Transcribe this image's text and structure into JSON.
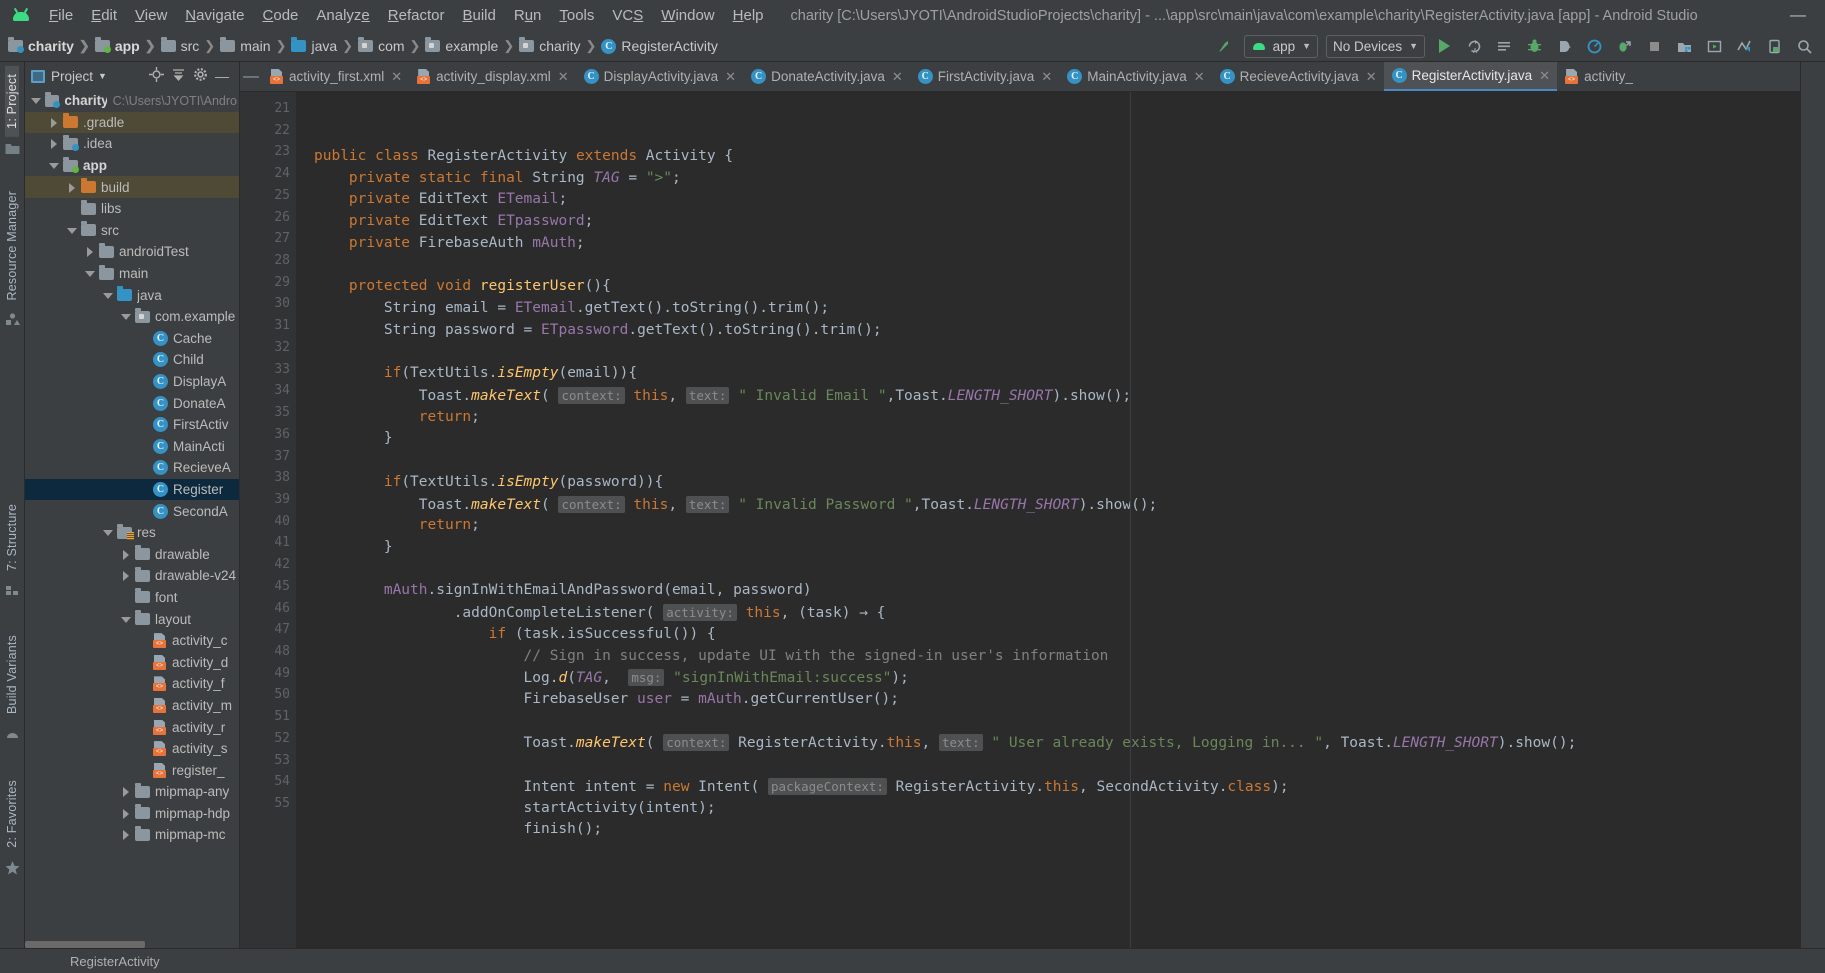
{
  "window": {
    "title": "charity [C:\\Users\\JYOTI\\AndroidStudioProjects\\charity] - ...\\app\\src\\main\\java\\com\\example\\charity\\RegisterActivity.java [app] - Android Studio",
    "minimize_label": "—"
  },
  "menubar": {
    "logo": "android-logo",
    "items": [
      "File",
      "Edit",
      "View",
      "Navigate",
      "Code",
      "Analyze",
      "Refactor",
      "Build",
      "Run",
      "Tools",
      "VCS",
      "Window",
      "Help"
    ]
  },
  "navbar": {
    "breadcrumbs": [
      {
        "label": "charity",
        "icon": "folder-module-icon",
        "bold": true
      },
      {
        "label": "app",
        "icon": "folder-module-green-icon",
        "bold": true
      },
      {
        "label": "src",
        "icon": "folder-icon",
        "bold": false
      },
      {
        "label": "main",
        "icon": "folder-icon",
        "bold": false
      },
      {
        "label": "java",
        "icon": "folder-blue-icon",
        "bold": false
      },
      {
        "label": "com",
        "icon": "package-icon",
        "bold": false
      },
      {
        "label": "example",
        "icon": "package-icon",
        "bold": false
      },
      {
        "label": "charity",
        "icon": "package-icon",
        "bold": false
      },
      {
        "label": "RegisterActivity",
        "icon": "class-icon",
        "bold": false
      }
    ],
    "run_config": "app",
    "device_selector": "No Devices",
    "icons": [
      "make-project-icon",
      "run-icon",
      "apply-changes-icon",
      "apply-code-changes-icon",
      "debug-icon",
      "attach-debugger-icon",
      "profiler-icon",
      "attach-debugger-android-icon",
      "stop-icon",
      "sdk-manager-icon",
      "avd-manager-icon",
      "layout-inspector-icon",
      "device-file-explorer-icon",
      "search-icon"
    ]
  },
  "left_strip": {
    "tabs": [
      {
        "label": "1: Project",
        "active": true
      },
      {
        "label": "Resource Manager",
        "active": false
      },
      {
        "label": "7: Structure",
        "active": false
      },
      {
        "label": "Build Variants",
        "active": false
      },
      {
        "label": "2: Favorites",
        "active": false
      }
    ]
  },
  "project_panel": {
    "title": "Project",
    "header_icons": [
      "project-view-icon",
      "chevron-down-icon",
      "locate-icon",
      "collapse-all-icon",
      "gear-icon",
      "hide-icon"
    ],
    "tree": [
      {
        "label": "charity",
        "path": "C:\\Users\\JYOTI\\Andro",
        "indent": 0,
        "arrow": "down",
        "icon": "folder-module-icon",
        "bold": true,
        "state": "normal"
      },
      {
        "label": ".gradle",
        "indent": 1,
        "arrow": "right",
        "icon": "folder-orange-icon",
        "bold": false,
        "state": "highlight"
      },
      {
        "label": ".idea",
        "indent": 1,
        "arrow": "right",
        "icon": "folder-module-icon",
        "bold": false,
        "state": "normal"
      },
      {
        "label": "app",
        "indent": 1,
        "arrow": "down",
        "icon": "folder-module-green-icon",
        "bold": true,
        "state": "normal"
      },
      {
        "label": "build",
        "indent": 2,
        "arrow": "right",
        "icon": "folder-orange-icon",
        "bold": false,
        "state": "highlight"
      },
      {
        "label": "libs",
        "indent": 2,
        "arrow": "none",
        "icon": "folder-icon",
        "bold": false,
        "state": "normal"
      },
      {
        "label": "src",
        "indent": 2,
        "arrow": "down",
        "icon": "folder-icon",
        "bold": false,
        "state": "normal"
      },
      {
        "label": "androidTest",
        "indent": 3,
        "arrow": "right",
        "icon": "folder-icon",
        "bold": false,
        "state": "normal"
      },
      {
        "label": "main",
        "indent": 3,
        "arrow": "down",
        "icon": "folder-icon",
        "bold": false,
        "state": "normal"
      },
      {
        "label": "java",
        "indent": 4,
        "arrow": "down",
        "icon": "folder-blue-icon",
        "bold": false,
        "state": "normal"
      },
      {
        "label": "com.example",
        "indent": 5,
        "arrow": "down",
        "icon": "package-icon",
        "bold": false,
        "state": "normal"
      },
      {
        "label": "Cache",
        "indent": 6,
        "arrow": "none",
        "icon": "class-icon",
        "bold": false,
        "state": "normal"
      },
      {
        "label": "Child",
        "indent": 6,
        "arrow": "none",
        "icon": "class-icon",
        "bold": false,
        "state": "normal"
      },
      {
        "label": "DisplayA",
        "indent": 6,
        "arrow": "none",
        "icon": "class-icon",
        "bold": false,
        "state": "normal"
      },
      {
        "label": "DonateA",
        "indent": 6,
        "arrow": "none",
        "icon": "class-icon",
        "bold": false,
        "state": "normal"
      },
      {
        "label": "FirstActiv",
        "indent": 6,
        "arrow": "none",
        "icon": "class-icon",
        "bold": false,
        "state": "normal"
      },
      {
        "label": "MainActi",
        "indent": 6,
        "arrow": "none",
        "icon": "class-icon",
        "bold": false,
        "state": "normal"
      },
      {
        "label": "RecieveA",
        "indent": 6,
        "arrow": "none",
        "icon": "class-icon",
        "bold": false,
        "state": "normal"
      },
      {
        "label": "Register",
        "indent": 6,
        "arrow": "none",
        "icon": "class-icon",
        "bold": false,
        "state": "selected"
      },
      {
        "label": "SecondA",
        "indent": 6,
        "arrow": "none",
        "icon": "class-icon",
        "bold": false,
        "state": "normal"
      },
      {
        "label": "res",
        "indent": 4,
        "arrow": "down",
        "icon": "folder-res-icon",
        "bold": false,
        "state": "normal"
      },
      {
        "label": "drawable",
        "indent": 5,
        "arrow": "right",
        "icon": "folder-icon",
        "bold": false,
        "state": "normal"
      },
      {
        "label": "drawable-v24",
        "indent": 5,
        "arrow": "right",
        "icon": "folder-icon",
        "bold": false,
        "state": "normal"
      },
      {
        "label": "font",
        "indent": 5,
        "arrow": "none",
        "icon": "folder-icon",
        "bold": false,
        "state": "normal"
      },
      {
        "label": "layout",
        "indent": 5,
        "arrow": "down",
        "icon": "folder-icon",
        "bold": false,
        "state": "normal"
      },
      {
        "label": "activity_c",
        "indent": 6,
        "arrow": "none",
        "icon": "xml-icon",
        "bold": false,
        "state": "normal"
      },
      {
        "label": "activity_d",
        "indent": 6,
        "arrow": "none",
        "icon": "xml-icon",
        "bold": false,
        "state": "normal"
      },
      {
        "label": "activity_f",
        "indent": 6,
        "arrow": "none",
        "icon": "xml-icon",
        "bold": false,
        "state": "normal"
      },
      {
        "label": "activity_m",
        "indent": 6,
        "arrow": "none",
        "icon": "xml-icon",
        "bold": false,
        "state": "normal"
      },
      {
        "label": "activity_r",
        "indent": 6,
        "arrow": "none",
        "icon": "xml-icon",
        "bold": false,
        "state": "normal"
      },
      {
        "label": "activity_s",
        "indent": 6,
        "arrow": "none",
        "icon": "xml-icon",
        "bold": false,
        "state": "normal"
      },
      {
        "label": "register_",
        "indent": 6,
        "arrow": "none",
        "icon": "xml-icon",
        "bold": false,
        "state": "normal"
      },
      {
        "label": "mipmap-any",
        "indent": 5,
        "arrow": "right",
        "icon": "folder-icon",
        "bold": false,
        "state": "normal"
      },
      {
        "label": "mipmap-hdp",
        "indent": 5,
        "arrow": "right",
        "icon": "folder-icon",
        "bold": false,
        "state": "normal"
      },
      {
        "label": "mipmap-mc",
        "indent": 5,
        "arrow": "right",
        "icon": "folder-icon",
        "bold": false,
        "state": "normal"
      }
    ]
  },
  "editor_tabs": [
    {
      "label": "activity_first.xml",
      "icon": "xml-icon",
      "active": false
    },
    {
      "label": "activity_display.xml",
      "icon": "xml-icon",
      "active": false
    },
    {
      "label": "DisplayActivity.java",
      "icon": "class-icon",
      "active": false
    },
    {
      "label": "DonateActivity.java",
      "icon": "class-icon",
      "active": false
    },
    {
      "label": "FirstActivity.java",
      "icon": "class-icon",
      "active": false
    },
    {
      "label": "MainActivity.java",
      "icon": "class-icon",
      "active": false
    },
    {
      "label": "RecieveActivity.java",
      "icon": "class-icon",
      "active": false
    },
    {
      "label": "RegisterActivity.java",
      "icon": "class-icon",
      "active": true
    },
    {
      "label": "activity_",
      "icon": "xml-icon",
      "active": false
    }
  ],
  "editor": {
    "first_line_number": 21,
    "gutter_lines": [
      {
        "n": "21",
        "marker": "xml-layout-icon"
      },
      {
        "n": "22",
        "marker": ""
      },
      {
        "n": "23",
        "marker": ""
      },
      {
        "n": "24",
        "marker": ""
      },
      {
        "n": "25",
        "marker": ""
      },
      {
        "n": "26",
        "marker": ""
      },
      {
        "n": "27",
        "marker": "fold-minus"
      },
      {
        "n": "28",
        "marker": ""
      },
      {
        "n": "29",
        "marker": ""
      },
      {
        "n": "30",
        "marker": ""
      },
      {
        "n": "31",
        "marker": "fold-minus"
      },
      {
        "n": "32",
        "marker": ""
      },
      {
        "n": "33",
        "marker": ""
      },
      {
        "n": "34",
        "marker": "fold-end"
      },
      {
        "n": "35",
        "marker": ""
      },
      {
        "n": "36",
        "marker": "fold-minus"
      },
      {
        "n": "37",
        "marker": ""
      },
      {
        "n": "38",
        "marker": ""
      },
      {
        "n": "39",
        "marker": "fold-end"
      },
      {
        "n": "40",
        "marker": ""
      },
      {
        "n": "41",
        "marker": ""
      },
      {
        "n": "42",
        "marker": "green-run-arrow fold-minus"
      },
      {
        "n": "45",
        "marker": "fold-minus"
      },
      {
        "n": "46",
        "marker": ""
      },
      {
        "n": "47",
        "marker": ""
      },
      {
        "n": "48",
        "marker": ""
      },
      {
        "n": "49",
        "marker": ""
      },
      {
        "n": "50",
        "marker": ""
      },
      {
        "n": "51",
        "marker": ""
      },
      {
        "n": "52",
        "marker": ""
      },
      {
        "n": "53",
        "marker": ""
      },
      {
        "n": "54",
        "marker": ""
      },
      {
        "n": "55",
        "marker": ""
      }
    ],
    "code_lines": [
      "public class RegisterActivity extends Activity {",
      "    private static final String TAG = \">\";",
      "    private EditText ETemail;",
      "    private EditText ETpassword;",
      "    private FirebaseAuth mAuth;",
      "",
      "    protected void registerUser(){",
      "        String email = ETemail.getText().toString().trim();",
      "        String password = ETpassword.getText().toString().trim();",
      "",
      "        if(TextUtils.isEmpty(email)){",
      "            Toast.makeText( context: this, text: \" Invalid Email \",Toast.LENGTH_SHORT).show();",
      "            return;",
      "        }",
      "",
      "        if(TextUtils.isEmpty(password)){",
      "            Toast.makeText( context: this, text: \" Invalid Password \",Toast.LENGTH_SHORT).show();",
      "            return;",
      "        }",
      "",
      "        mAuth.signInWithEmailAndPassword(email, password)",
      "                .addOnCompleteListener( activity: this, (task) → {",
      "                    if (task.isSuccessful()) {",
      "                        // Sign in success, update UI with the signed-in user's information",
      "                        Log.d(TAG,  msg: \"signInWithEmail:success\");",
      "                        FirebaseUser user = mAuth.getCurrentUser();",
      "",
      "                        Toast.makeText( context: RegisterActivity.this, text: \" User already exists, Logging in... \", Toast.LENGTH_SHORT).show();",
      "",
      "                        Intent intent = new Intent( packageContext: RegisterActivity.this, SecondActivity.class);",
      "                        startActivity(intent);",
      "                        finish();",
      ""
    ]
  },
  "statusbar": {
    "text": "RegisterActivity"
  },
  "colors": {
    "accent_green": "#3ddc84",
    "accent_blue": "#3592c4",
    "selection": "#0d293e",
    "keyword": "#cc7832",
    "string": "#6a8759",
    "field": "#9876aa",
    "method": "#ffc66d",
    "comment": "#808080",
    "editor_bg": "#2b2b2b",
    "panel_bg": "#3c3f41"
  }
}
